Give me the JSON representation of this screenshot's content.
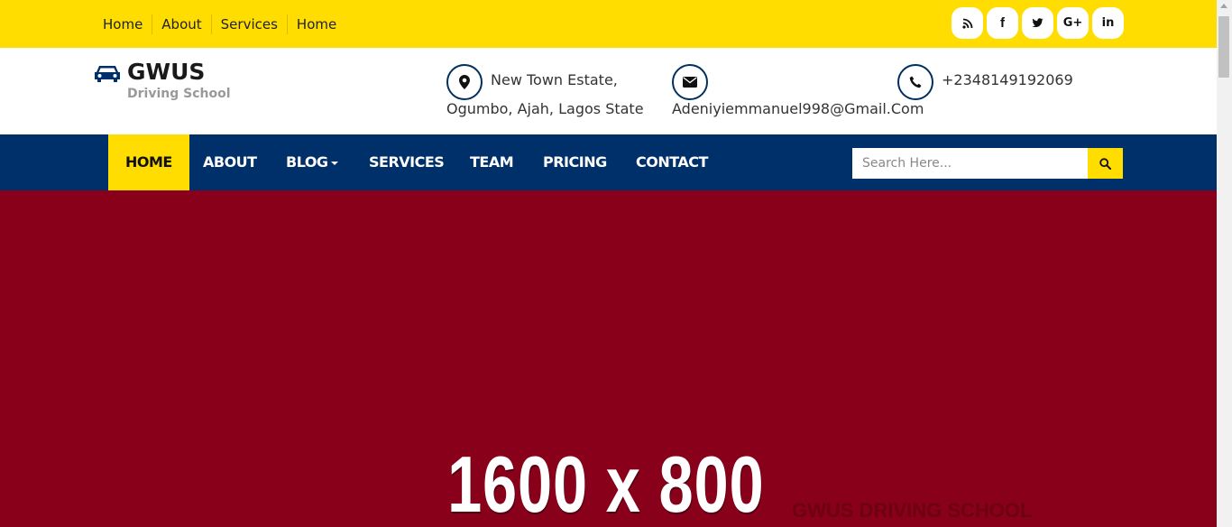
{
  "topbar": {
    "links": [
      "Home",
      "About",
      "Services",
      "Home"
    ],
    "social": [
      {
        "icon": "rss-icon",
        "glyph": "⦿"
      },
      {
        "icon": "facebook-icon",
        "glyph": "f"
      },
      {
        "icon": "twitter-icon",
        "glyph": "❧"
      },
      {
        "icon": "google-plus-icon",
        "glyph": "G+"
      },
      {
        "icon": "linkedin-icon",
        "glyph": "in"
      }
    ]
  },
  "brand": {
    "name": "GWUS",
    "tagline": "Driving School",
    "icon": "car-icon"
  },
  "contact": {
    "address_line1": "New Town Estate,",
    "address_line2": "Ogumbo, Ajah, Lagos State",
    "email": "Adeniyiemmanuel998@Gmail.Com",
    "phone": "+2348149192069"
  },
  "nav": {
    "items": [
      "HOME",
      "ABOUT",
      "BLOG",
      "SERVICES",
      "TEAM",
      "PRICING",
      "CONTACT"
    ],
    "active": "HOME",
    "search_placeholder": "Search Here..."
  },
  "hero": {
    "dimensions": "1600 x 800",
    "watermark": "GWUS DRIVING SCHOOL"
  },
  "colors": {
    "yellow": "#ffdd00",
    "navy": "#00306a",
    "hero": "#880019"
  }
}
